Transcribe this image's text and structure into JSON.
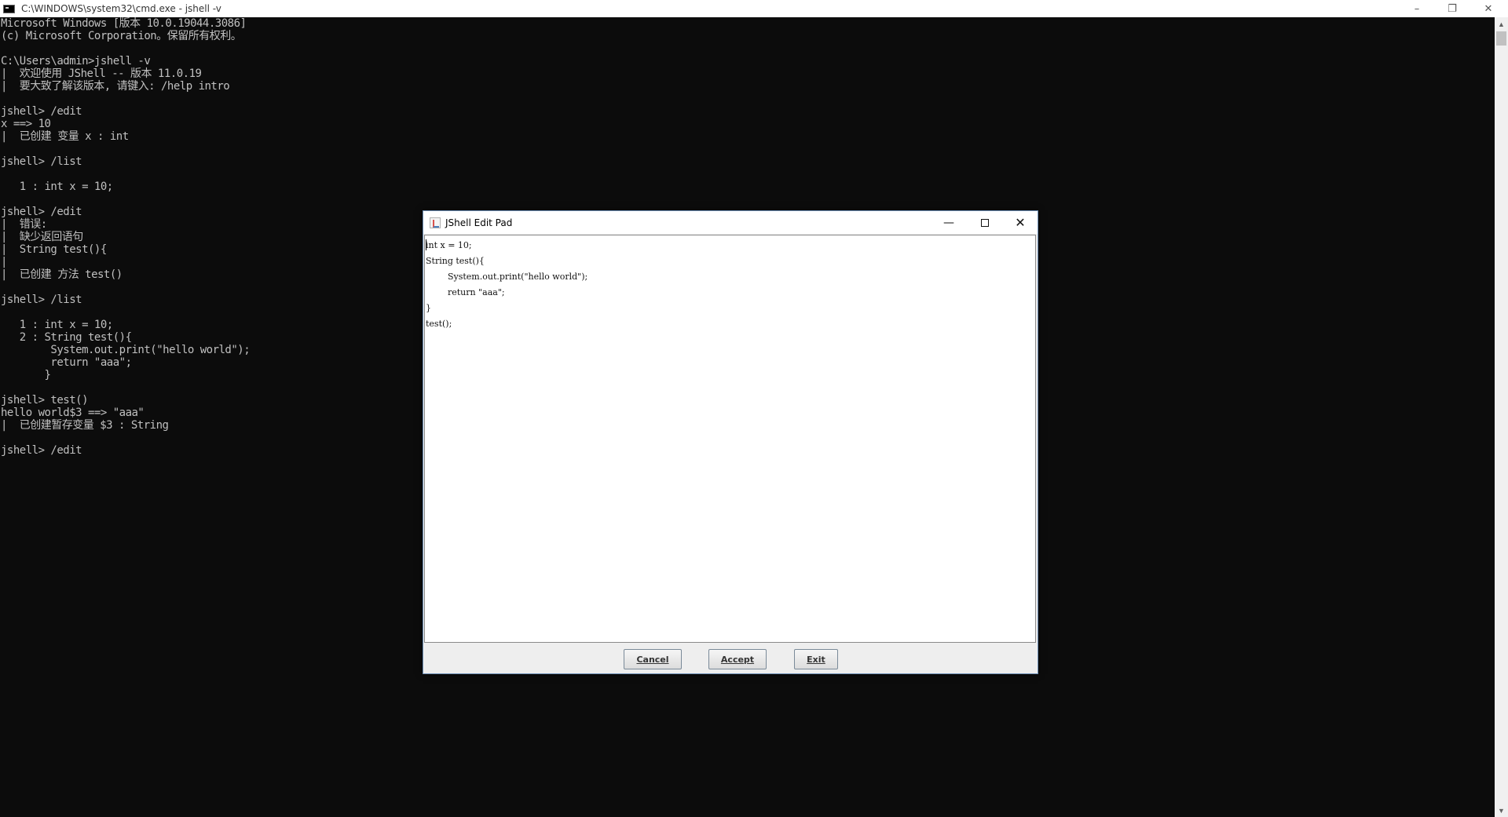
{
  "console_window": {
    "title": "C:\\WINDOWS\\system32\\cmd.exe - jshell  -v",
    "controls": {
      "minimize": "–",
      "maximize": "❐",
      "close": "✕"
    },
    "lines": [
      "Microsoft Windows [版本 10.0.19044.3086]",
      "(c) Microsoft Corporation。保留所有权利。",
      "",
      "C:\\Users\\admin>jshell -v",
      "|  欢迎使用 JShell -- 版本 11.0.19",
      "|  要大致了解该版本, 请键入: /help intro",
      "",
      "jshell> /edit",
      "x ==> 10",
      "|  已创建 变量 x : int",
      "",
      "jshell> /list",
      "",
      "   1 : int x = 10;",
      "",
      "jshell> /edit",
      "|  错误:",
      "|  缺少返回语句",
      "|  String test(){",
      "|",
      "|  已创建 方法 test()",
      "",
      "jshell> /list",
      "",
      "   1 : int x = 10;",
      "   2 : String test(){",
      "        System.out.print(\"hello world\");",
      "        return \"aaa\";",
      "       }",
      "",
      "jshell> test()",
      "hello world$3 ==> \"aaa\"",
      "|  已创建暂存变量 $3 : String",
      "",
      "jshell> /edit"
    ]
  },
  "scrollbar": {
    "up_arrow": "▲",
    "down_arrow": "▼"
  },
  "edit_pad": {
    "title": "JShell Edit Pad",
    "controls": {
      "minimize": "—",
      "close": "✕"
    },
    "code_lines": [
      "int x = 10;",
      "String test(){",
      "\tSystem.out.print(\"hello world\");",
      "\treturn \"aaa\";",
      "}",
      "test();"
    ],
    "buttons": {
      "cancel": "Cancel",
      "accept": "Accept",
      "exit": "Exit"
    }
  }
}
